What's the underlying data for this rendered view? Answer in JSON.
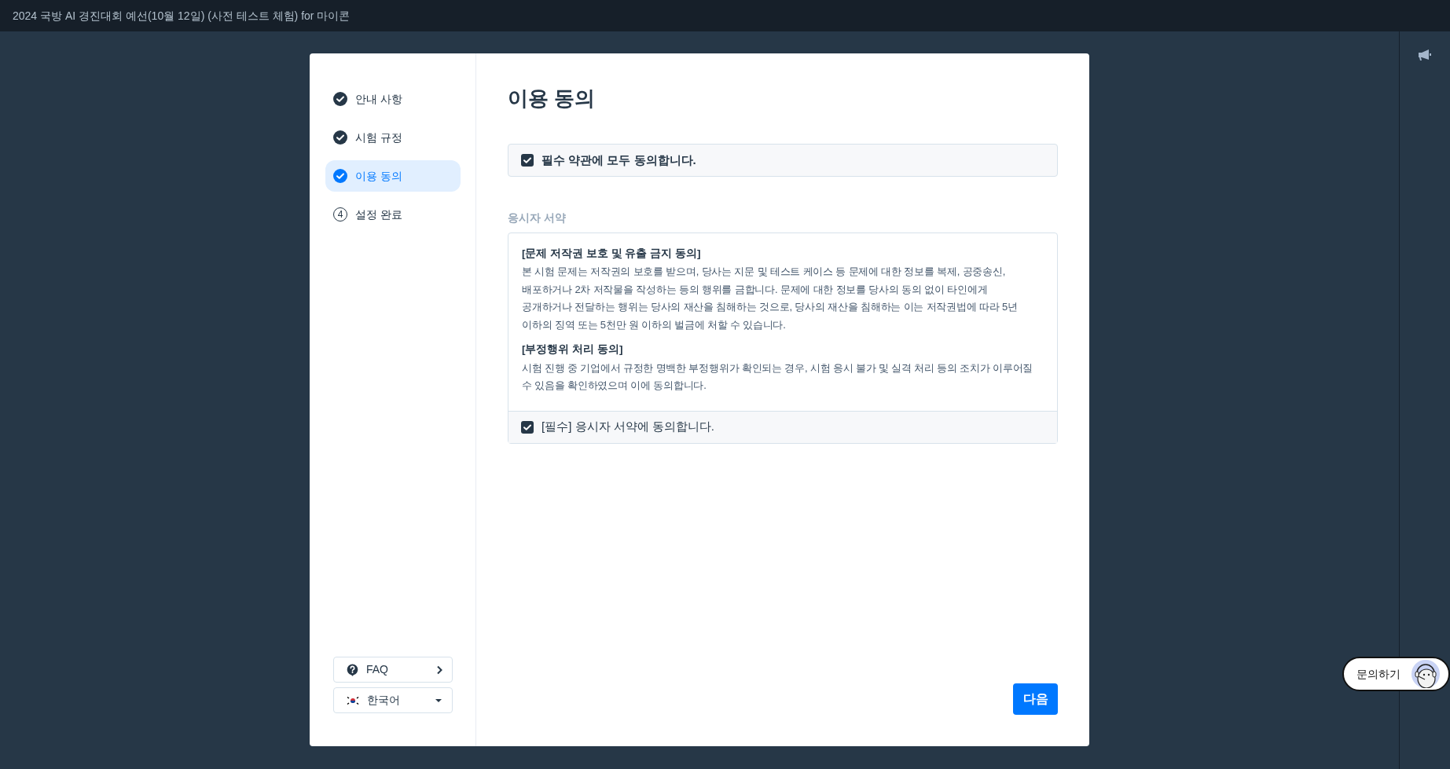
{
  "window": {
    "title": "2024 국방 AI 경진대회 예선(10월 12일) (사전 테스트 체험) for 마이콘"
  },
  "steps": [
    {
      "label": "안내 사항",
      "done": true,
      "selected": false
    },
    {
      "label": "시험 규정",
      "done": true,
      "selected": false
    },
    {
      "label": "이용 동의",
      "done": true,
      "selected": true
    },
    {
      "label": "설정 완료",
      "done": false,
      "number": "4",
      "selected": false
    }
  ],
  "sidebar_footer": {
    "faq": "FAQ",
    "language": "한국어"
  },
  "page_title": "이용 동의",
  "agree_all": {
    "label": "필수 약관에 모두 동의합니다.",
    "checked": true
  },
  "section_label": "응시자 서약",
  "terms": [
    {
      "heading": "[문제 저작권 보호 및 유출 금지 동의]",
      "body": "본 시험 문제는 저작권의 보호를 받으며, 당사는 지문 및 테스트 케이스 등 문제에 대한 정보를 복제, 공중송신,\n배포하거나 2차 저작물을 작성하는 등의 행위를 금합니다. 문제에 대한 정보를 당사의 동의 없이 타인에게\n공개하거나 전달하는 행위는 당사의 재산을 침해하는 것으로, 당사의 재산을 침해하는 이는 저작권법에 따라 5년\n이하의 징역 또는 5천만 원 이하의 벌금에 처할 수 있습니다."
    },
    {
      "heading": "[부정행위 처리 동의]",
      "body": "시험 진행 중 기업에서 규정한 명백한 부정행위가 확인되는 경우, 시험 응시 불가 및 실격 처리 등의 조치가 이루어질\n수 있음을 확인하였으며 이에 동의합니다."
    }
  ],
  "agree_terms": {
    "label": "[필수] 응시자 서약에 동의합니다.",
    "checked": true
  },
  "next_button": "다음",
  "help_button": "문의하기"
}
